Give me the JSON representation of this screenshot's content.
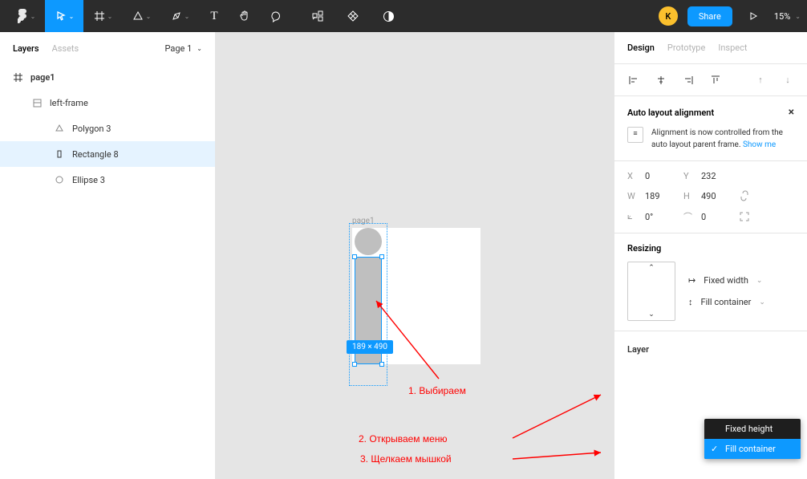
{
  "toolbar": {
    "avatar_initial": "K",
    "share_label": "Share",
    "zoom": "15%"
  },
  "left_panel": {
    "tabs": {
      "layers": "Layers",
      "assets": "Assets"
    },
    "page_selector": "Page 1",
    "layers": [
      {
        "name": "page1",
        "icon": "frame"
      },
      {
        "name": "left-frame",
        "icon": "frame"
      },
      {
        "name": "Polygon 3",
        "icon": "polygon"
      },
      {
        "name": "Rectangle 8",
        "icon": "rect"
      },
      {
        "name": "Ellipse 3",
        "icon": "ellipse"
      }
    ]
  },
  "canvas": {
    "frame_label": "page1",
    "size_badge": "189 × 490",
    "annotations": {
      "a1": "1. Выбираем",
      "a2": "2. Открываем меню",
      "a3": "3. Щелкаем мышкой"
    }
  },
  "right_panel": {
    "tabs": {
      "design": "Design",
      "prototype": "Prototype",
      "inspect": "Inspect"
    },
    "auto_layout": {
      "title": "Auto layout alignment",
      "hint_text": "Alignment is now controlled from the auto layout parent frame. ",
      "hint_link": "Show me"
    },
    "props": {
      "x_label": "X",
      "x_val": "0",
      "y_label": "Y",
      "y_val": "232",
      "w_label": "W",
      "w_val": "189",
      "h_label": "H",
      "h_val": "490",
      "r_label": "⟀",
      "r_val": "0°",
      "c_label": "⌒",
      "c_val": "0"
    },
    "resizing": {
      "title": "Resizing",
      "width_opt": "Fixed width",
      "height_opt": "Fill container"
    },
    "layer_section": "Layer",
    "dropdown": {
      "opt1": "Fixed height",
      "opt2": "Fill container"
    }
  }
}
